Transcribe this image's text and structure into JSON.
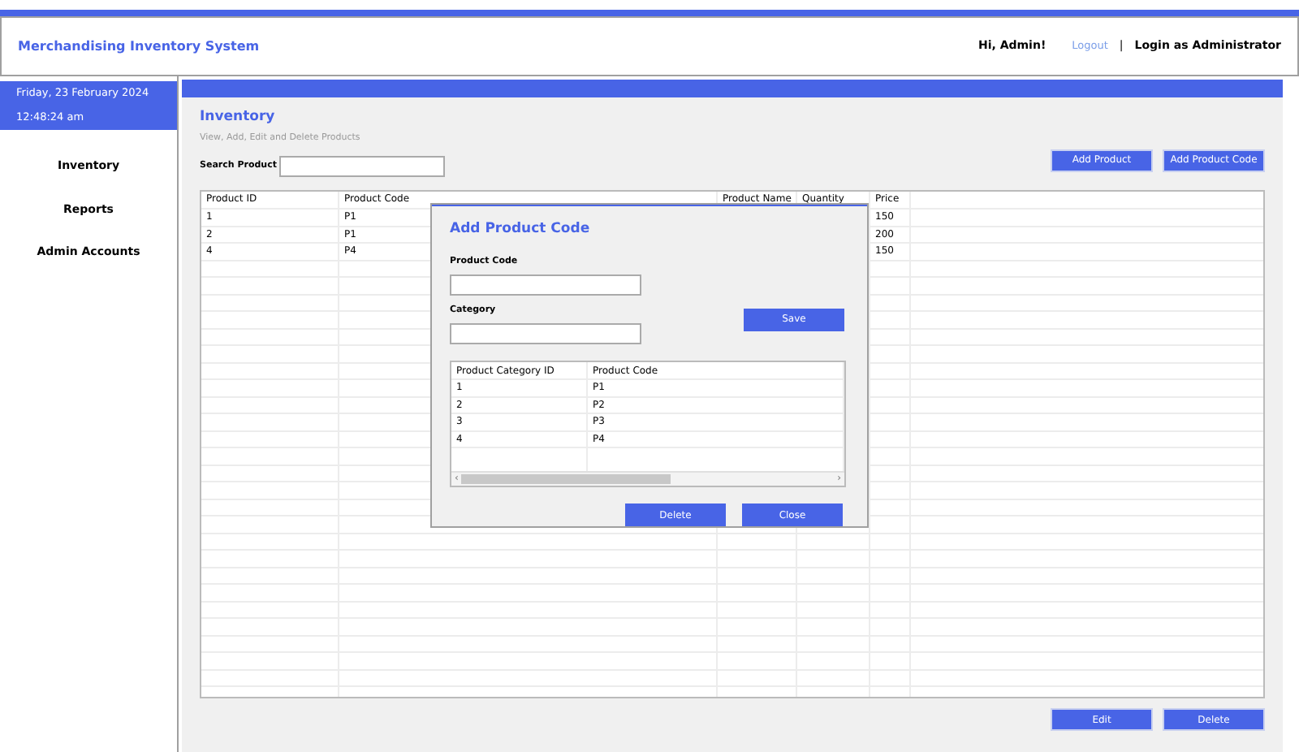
{
  "app_title": "Merchandising Inventory System",
  "header": {
    "greeting": "Hi, Admin!",
    "logout": "Logout",
    "separator": "|",
    "role": "Login as Administrator"
  },
  "sidebar": {
    "date": "Friday, 23 February 2024",
    "time": "12:48:24 am",
    "items": [
      {
        "label": "Inventory"
      },
      {
        "label": "Reports"
      },
      {
        "label": "Admin Accounts"
      }
    ]
  },
  "page": {
    "title": "Inventory",
    "subtitle": "View, Add, Edit and Delete Products",
    "search": {
      "label": "Search Product"
    },
    "top_buttons": [
      "Add Product",
      "Add Product Code"
    ],
    "bottom_buttons": [
      "Edit",
      "Delete"
    ]
  },
  "table": {
    "columns": [
      "Product ID",
      "Product Code",
      "Product Name",
      "Quantity",
      "Price"
    ],
    "rows": [
      {
        "product_id": "1",
        "product_code": "P1",
        "price": "150"
      },
      {
        "product_id": "2",
        "product_code": "P1",
        "price": "200"
      },
      {
        "product_id": "4",
        "product_code": "P4",
        "price": "150"
      }
    ]
  },
  "dialog": {
    "title": "Add Product Code",
    "fields": [
      {
        "label": "Product Code"
      },
      {
        "label": "Category"
      }
    ],
    "save": "Save",
    "table": {
      "columns": [
        "Product Category ID",
        "Product Code"
      ],
      "rows": [
        [
          "1",
          "P1"
        ],
        [
          "2",
          "P2"
        ],
        [
          "3",
          "P3"
        ],
        [
          "4",
          "P4"
        ]
      ]
    },
    "scroll_left": "‹",
    "scroll_right": "›",
    "buttons": [
      "Delete",
      "Close"
    ]
  }
}
